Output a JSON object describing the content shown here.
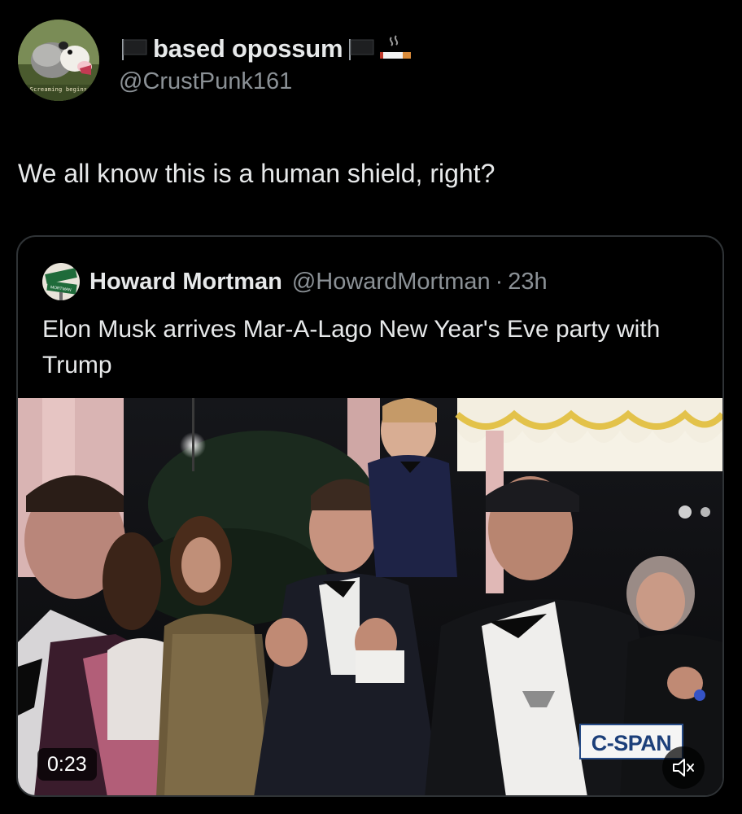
{
  "tweet": {
    "author": {
      "display_name": "based opossum",
      "handle": "@CrustPunk161",
      "avatar_caption": "Screaming begins",
      "name_emojis": [
        "black-flag-icon",
        "black-flag-icon",
        "cigarette-icon"
      ]
    },
    "text": "We all know this is a human shield, right?"
  },
  "quoted_tweet": {
    "author": {
      "display_name": "Howard Mortman",
      "handle": "@HowardMortman",
      "avatar_sign_text": "MORTMAN"
    },
    "separator": "·",
    "time": "23h",
    "text": "Elon Musk arrives Mar-A-Lago New Year's Eve party with Trump",
    "video": {
      "timestamp": "0:23",
      "watermark": "C-SPAN",
      "mute_icon": "speaker-muted-icon"
    }
  },
  "colors": {
    "background": "#000000",
    "text_primary": "#e7e9ea",
    "text_secondary": "#8b9196",
    "card_border": "#2f3336",
    "cspan_blue": "#1c3f7a"
  }
}
